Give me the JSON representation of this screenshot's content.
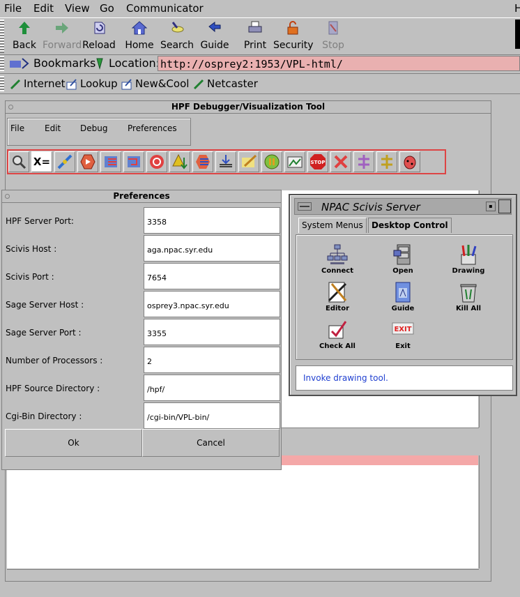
{
  "menubar": {
    "items": [
      "File",
      "Edit",
      "View",
      "Go",
      "Communicator"
    ],
    "right": "H"
  },
  "toolbar": {
    "buttons": [
      {
        "label": "Back",
        "icon": "back-arrow-icon"
      },
      {
        "label": "Forward",
        "icon": "forward-arrow-icon",
        "disabled": true
      },
      {
        "label": "Reload",
        "icon": "reload-icon"
      },
      {
        "label": "Home",
        "icon": "home-icon"
      },
      {
        "label": "Search",
        "icon": "search-icon"
      },
      {
        "label": "Guide",
        "icon": "guide-icon"
      },
      {
        "label": "Print",
        "icon": "printer-icon"
      },
      {
        "label": "Security",
        "icon": "lock-icon"
      },
      {
        "label": "Stop",
        "icon": "stop-icon",
        "disabled": true
      }
    ]
  },
  "location": {
    "bookmarks_label": "Bookmarks",
    "location_label": "Location:",
    "url": "http://osprey2:1953/VPL-html/"
  },
  "personal": {
    "items": [
      "Internet",
      "Lookup",
      "New&Cool",
      "Netcaster"
    ]
  },
  "hpf": {
    "title": "HPF Debugger/Visualization Tool",
    "menu": [
      "File",
      "Edit",
      "Debug",
      "Preferences"
    ]
  },
  "preferences": {
    "title": "Preferences",
    "fields": [
      {
        "label": "HPF Server Port:",
        "value": "3358"
      },
      {
        "label": "Scivis Host :",
        "value": "aga.npac.syr.edu"
      },
      {
        "label": "Scivis Port :",
        "value": "7654"
      },
      {
        "label": "Sage Server Host :",
        "value": "osprey3.npac.syr.edu"
      },
      {
        "label": "Sage Server Port :",
        "value": "3355"
      },
      {
        "label": "Number of Processors :",
        "value": "2"
      },
      {
        "label": "HPF Source Directory :",
        "value": "/hpf/"
      },
      {
        "label": "Cgi-Bin Directory :",
        "value": "/cgi-bin/VPL-bin/"
      }
    ],
    "ok_label": "Ok",
    "cancel_label": "Cancel"
  },
  "scivis": {
    "title": "NPAC Scivis Server",
    "tabs": [
      "System Menus",
      "Desktop Control"
    ],
    "items": [
      {
        "label": "Connect",
        "icon": "network-icon"
      },
      {
        "label": "Open",
        "icon": "file-cabinet-icon"
      },
      {
        "label": "Drawing",
        "icon": "pencils-icon"
      },
      {
        "label": "Editor",
        "icon": "editor-icon"
      },
      {
        "label": "Guide",
        "icon": "guide-book-icon"
      },
      {
        "label": "Kill All",
        "icon": "trash-can-icon"
      },
      {
        "label": "Check All",
        "icon": "checkmark-icon"
      },
      {
        "label": "Exit",
        "icon": "exit-icon"
      }
    ],
    "status": "Invoke drawing tool."
  },
  "colors": {
    "location_bg": "#e9b0b0",
    "toolbar_border": "#dd4444",
    "status_text": "#1f3fd0"
  }
}
